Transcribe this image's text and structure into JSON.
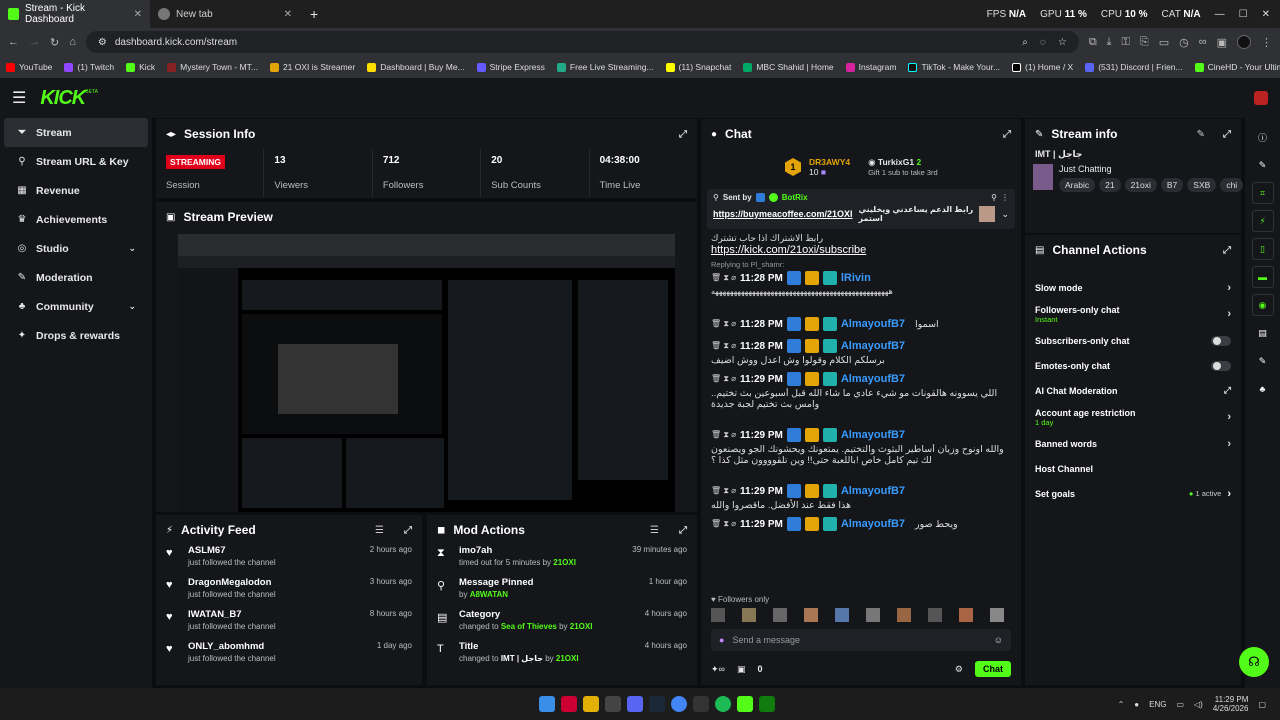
{
  "browser": {
    "tabs": [
      {
        "title": "Stream - Kick Dashboard",
        "active": true
      },
      {
        "title": "New tab",
        "active": false
      }
    ],
    "new_tab_icon": "+",
    "stats": {
      "fps_label": "FPS",
      "fps_value": "N/A",
      "gpu_label": "GPU",
      "gpu_value": "11 %",
      "cpu_label": "CPU",
      "cpu_value": "10 %",
      "cat_label": "CAT",
      "cat_value": "N/A"
    },
    "url": "dashboard.kick.com/stream",
    "bookmarks": [
      "YouTube",
      "(1) Twitch",
      "Kick",
      "Mystery Town - MT...",
      "21 OXI is Streamer",
      "Dashboard | Buy Me...",
      "Stripe Express",
      "Free Live Streaming...",
      "(11) Snapchat",
      "MBC Shahid | Home",
      "Instagram",
      "TikTok - Make Your...",
      "(1) Home / X",
      "(531) Discord | Frien...",
      "CineHD - Your Ultim..."
    ]
  },
  "header": {
    "logo": "KICK",
    "beta": "BETA"
  },
  "sidebar": {
    "items": [
      {
        "label": "Stream",
        "icon": "stream-icon"
      },
      {
        "label": "Stream URL & Key",
        "icon": "link-icon"
      },
      {
        "label": "Revenue",
        "icon": "revenue-icon"
      },
      {
        "label": "Achievements",
        "icon": "trophy-icon"
      },
      {
        "label": "Studio",
        "icon": "studio-icon"
      },
      {
        "label": "Moderation",
        "icon": "wrench-icon"
      },
      {
        "label": "Community",
        "icon": "community-icon"
      },
      {
        "label": "Drops & rewards",
        "icon": "gift-icon"
      }
    ]
  },
  "session": {
    "title": "Session Info",
    "status_badge": "STREAMING",
    "status_label": "Session",
    "viewers_value": "13",
    "viewers_label": "Viewers",
    "followers_value": "712",
    "followers_label": "Followers",
    "subs_value": "20",
    "subs_label": "Sub Counts",
    "time_value": "04:38:00",
    "time_label": "Time Live"
  },
  "preview": {
    "title": "Stream Preview"
  },
  "activity": {
    "title": "Activity Feed",
    "rows": [
      {
        "name": "ASLM67",
        "action": "just followed the channel",
        "time": "2 hours ago"
      },
      {
        "name": "DragonMegalodon",
        "action": "just followed the channel",
        "time": "3 hours ago"
      },
      {
        "name": "IWATAN_B7",
        "action": "just followed the channel",
        "time": "8 hours ago"
      },
      {
        "name": "ONLY_abomhmd",
        "action": "just followed the channel",
        "time": "1 day ago"
      }
    ]
  },
  "mod": {
    "title": "Mod Actions",
    "rows": [
      {
        "title": "imo7ah",
        "detail": "timed out for 5 minutes by",
        "by": "21OXI",
        "time": "39 minutes ago"
      },
      {
        "title": "Message Pinned",
        "detail": "by",
        "by": "A8WATAN",
        "time": "1 hour ago"
      },
      {
        "title": "Category",
        "detail": "changed to",
        "target": "Sea of Thieves",
        "by_prefix": "by",
        "by": "21OXI",
        "time": "4 hours ago"
      },
      {
        "title": "Title",
        "detail": "changed to",
        "target": "IMT | جاجل",
        "by_prefix": "by",
        "by": "21OXI",
        "time": "4 hours ago"
      }
    ]
  },
  "chat": {
    "title": "Chat",
    "gifter_rank": "1",
    "gifter_name": "DR3AWY4",
    "gifter_count": "10",
    "gifter2_name": "TurkixG1",
    "gifter2_count": "2",
    "gifter2_note": "Gift 1 sub to take 3rd",
    "pinned_label": "Sent by",
    "pinned_user": "BotRix",
    "pinned_link": "https://buymeacoffee.com/21OXI",
    "pinned_text": "رابط الدعم يساعدني ويخليني استمر",
    "messages": [
      {
        "time": "11:28 PM",
        "user": "BotRix",
        "bot": true,
        "text": "رابط الاشتراك اذا حاب تشترك",
        "link": "https://kick.com/21oxi/subscribe"
      },
      {
        "time": "11:28 PM",
        "user": "lRivin",
        "reply": "Replying to Pl_shamr: ",
        "text": "ههههههههههههههههههههههههههههههههههههههههههههههههه"
      },
      {
        "time": "11:28 PM",
        "user": "AlmayoufB7",
        "text": "اسموا"
      },
      {
        "time": "11:28 PM",
        "user": "AlmayoufB7",
        "text": "برسلكم الكلام وقولوا وش اعدل ووش اضيف"
      },
      {
        "time": "11:29 PM",
        "user": "AlmayoufB7",
        "text": "اللي يسوونه هالقونات مو شيء عادي ما شاء الله قبل أسبوعين بث تختيم.. وامس بث تختيم لجبة جديدة"
      },
      {
        "time": "11:29 PM",
        "user": "AlmayoufB7",
        "text": "والله اونوح وزيان أساطير البثوث والتختيم. يمتعونك ويحشونك الجو ويصنعون لك تيم كامل خاص !باللعبة حتى!! وين تلقوووون مثل كذا ؟"
      },
      {
        "time": "11:29 PM",
        "user": "AlmayoufB7",
        "text": "هذا فقط عند الأفضل. ماقصروا والله"
      },
      {
        "time": "11:29 PM",
        "user": "AlmayoufB7",
        "text": "ويحط صور"
      }
    ],
    "followers_only": "Followers only",
    "input_placeholder": "Send a message",
    "points": "0",
    "send": "Chat"
  },
  "stream_info": {
    "title": "Stream info",
    "stream_title": "IMT | جاجل",
    "category": "Just Chatting",
    "tags": [
      "Arabic",
      "21",
      "21oxi",
      "B7",
      "SXB",
      "chi"
    ]
  },
  "channel_actions": {
    "title": "Channel Actions",
    "items": [
      {
        "label": "Slow mode",
        "type": "arrow"
      },
      {
        "label": "Followers-only chat",
        "sub": "Instant",
        "type": "arrow"
      },
      {
        "label": "Subscribers-only chat",
        "type": "toggle"
      },
      {
        "label": "Emotes-only chat",
        "type": "toggle"
      },
      {
        "label": "AI Chat Moderation",
        "type": "external"
      },
      {
        "label": "Account age restriction",
        "sub": "1 day",
        "type": "arrow"
      },
      {
        "label": "Banned words",
        "type": "arrow"
      },
      {
        "label": "Host Channel",
        "type": "none"
      },
      {
        "label": "Set goals",
        "status": "1 active",
        "type": "arrow"
      }
    ]
  },
  "taskbar": {
    "lang": "ENG",
    "time": "11:29 PM",
    "date": "4/26/2026"
  },
  "colors": {
    "accent": "#53fc18",
    "live": "#e0001b",
    "username": "#3a9bff"
  }
}
